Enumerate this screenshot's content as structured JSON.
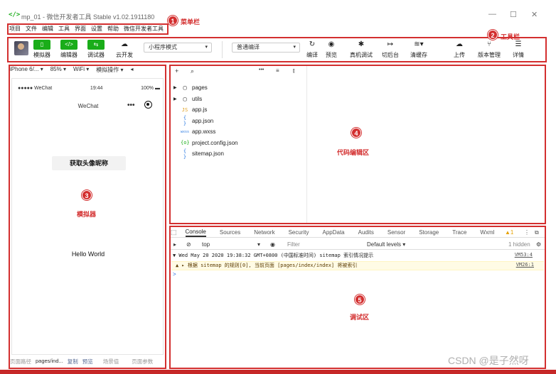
{
  "window": {
    "title": "mp_01 - 微信开发者工具 Stable v1.02.1911180",
    "app_icon": "code-brackets-icon",
    "controls": [
      "—",
      "☐",
      "✕"
    ]
  },
  "menubar": {
    "items": [
      "项目",
      "文件",
      "编辑",
      "工具",
      "界面",
      "设置",
      "帮助",
      "微信开发者工具"
    ]
  },
  "toolbar": {
    "simulator": "模拟器",
    "editor": "编辑器",
    "debugger": "调试器",
    "cloud": "云开发",
    "mode_select": "小程序模式",
    "compile_select": "普通编译",
    "compile": "编译",
    "preview": "预览",
    "remote_debug": "真机调试",
    "background": "切后台",
    "clear_cache": "清缓存",
    "upload": "上传",
    "version": "版本管理",
    "details": "详情",
    "accent_color": "#1aad19"
  },
  "simulator": {
    "device": "iPhone 6/...",
    "zoom": "85%",
    "network": "WiFi",
    "operation": "模拟操作",
    "status_left": "●●●●● WeChat",
    "status_time": "19:44",
    "status_battery": "100%",
    "nav_title": "WeChat",
    "nav_dots": "•••",
    "button_text": "获取头像昵称",
    "hello_text": "Hello World",
    "footer": {
      "path_label": "页面路径",
      "path_value": "pages/ind...",
      "copy": "复制",
      "preview": "预览",
      "scene": "场景值",
      "params": "页面参数"
    }
  },
  "explorer": {
    "add": "+",
    "search": "⌕",
    "more": "•••",
    "files": [
      {
        "name": "pages",
        "kind": "folder",
        "icon": "▢"
      },
      {
        "name": "utils",
        "kind": "folder",
        "icon": "▢"
      },
      {
        "name": "app.js",
        "kind": "file",
        "icon": "JS"
      },
      {
        "name": "app.json",
        "kind": "file",
        "icon": "{ }"
      },
      {
        "name": "app.wxss",
        "kind": "file",
        "icon": "wxss"
      },
      {
        "name": "project.config.json",
        "kind": "file",
        "icon": "{o}"
      },
      {
        "name": "sitemap.json",
        "kind": "file",
        "icon": "{ }"
      }
    ]
  },
  "devtools": {
    "tabs": [
      "Console",
      "Sources",
      "Network",
      "Security",
      "AppData",
      "Audits",
      "Sensor",
      "Storage",
      "Trace",
      "Wxml"
    ],
    "warn_count": "1",
    "context": "top",
    "filter_placeholder": "Filter",
    "levels": "Default levels ▾",
    "hidden": "1 hidden",
    "log_line1": "▼ Wed May 20 2020 19:38:32 GMT+0800 (中国标准时间) sitemap 索引情况提示",
    "log_line1_link": "VM53:4",
    "log_line2": "▲ ▸ 根据 sitemap 的规则[0], 当前页面 [pages/index/index] 将被索引",
    "log_line2_link": "VM26:1",
    "prompt": ">"
  },
  "annotations": {
    "menubar": {
      "num": "1",
      "label": "菜单栏"
    },
    "toolbar": {
      "num": "2",
      "label": "工具栏"
    },
    "simulator": {
      "num": "3",
      "label": "模拟器"
    },
    "editor": {
      "num": "4",
      "label": "代码编辑区"
    },
    "debug": {
      "num": "5",
      "label": "调试区"
    },
    "color": "#d32f2f"
  },
  "watermark": "CSDN @是子然呀"
}
